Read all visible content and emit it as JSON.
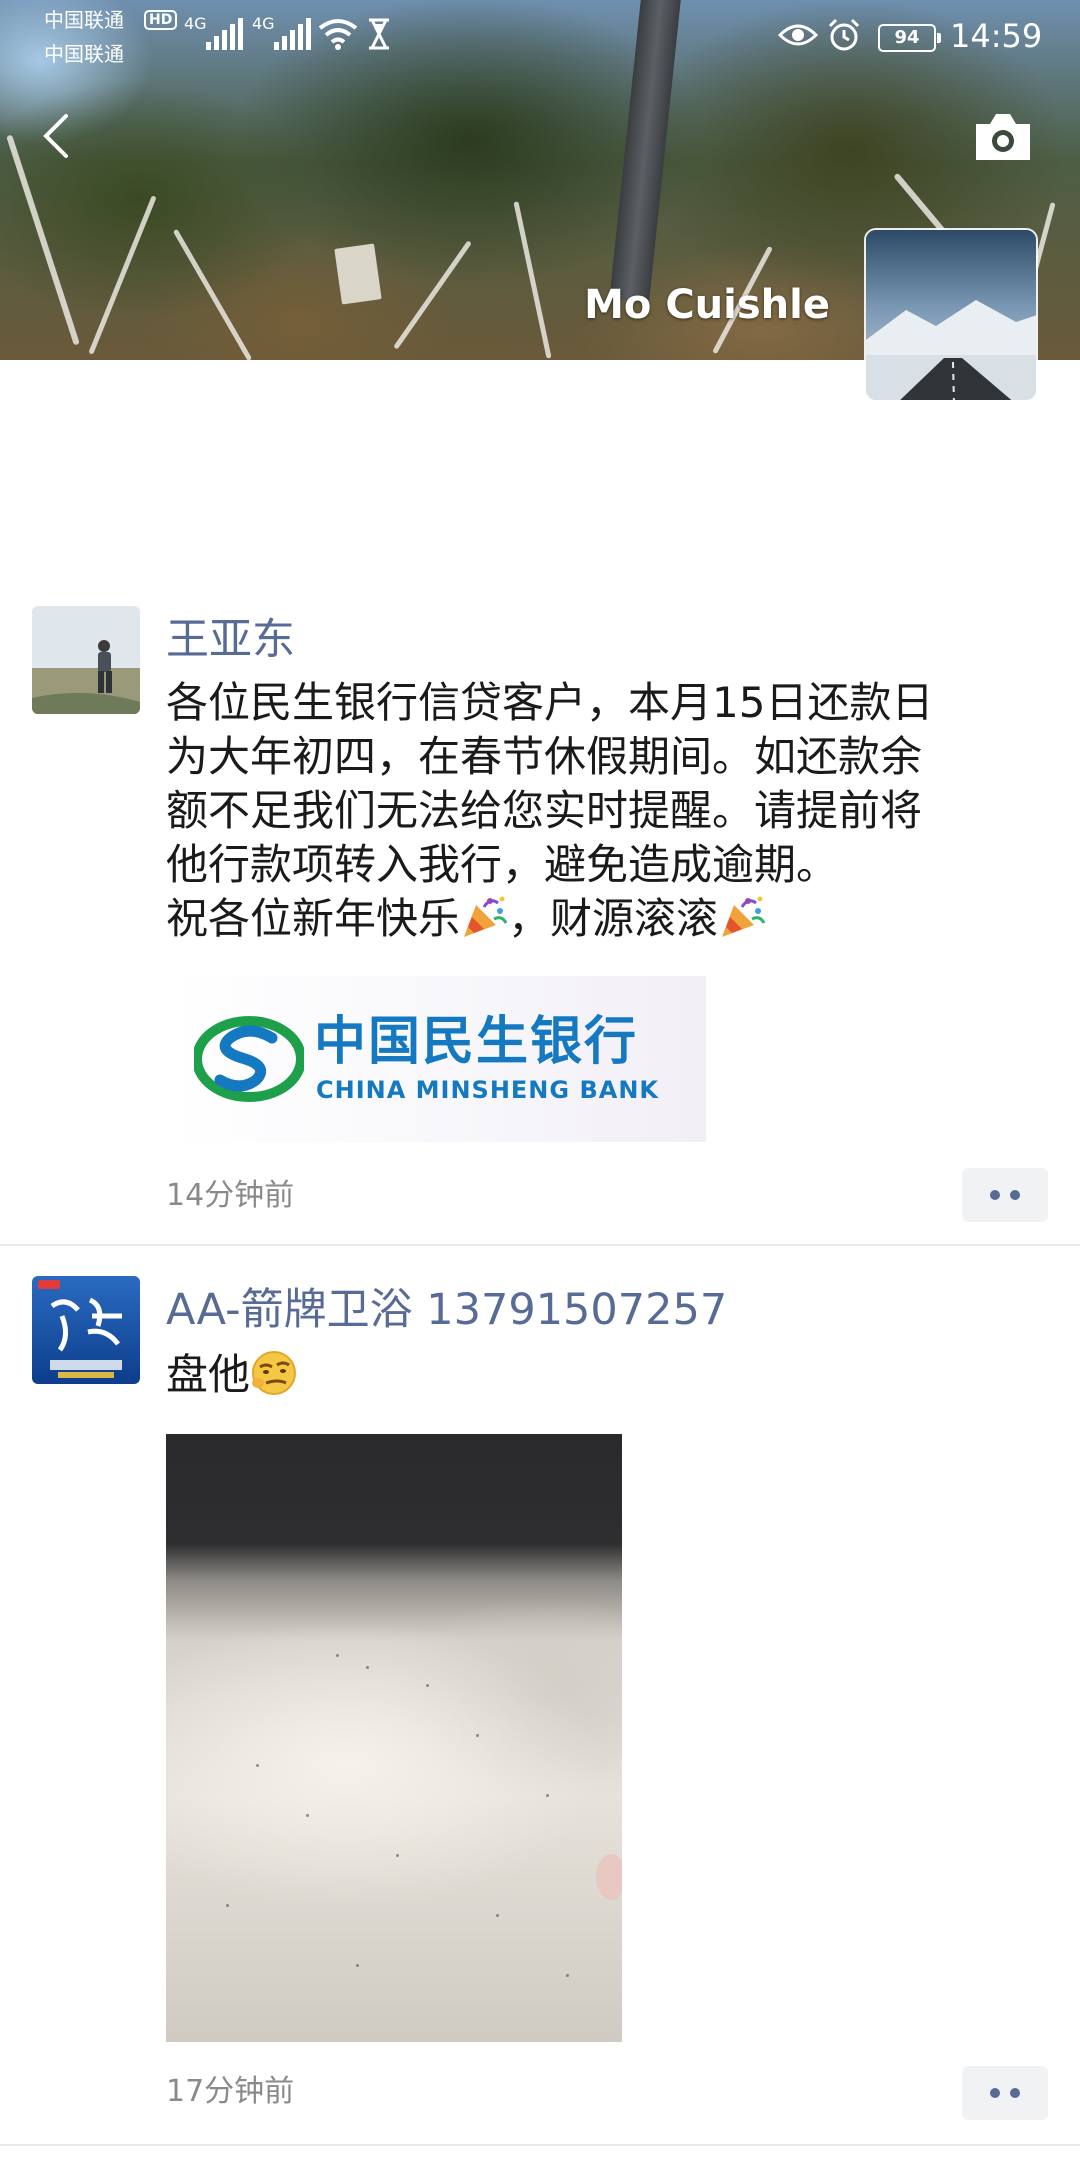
{
  "status_bar": {
    "carrier_1": "中国联通",
    "carrier_2": "中国联通",
    "hd_badge": "HD",
    "network_1": "4G",
    "network_2": "4G",
    "battery": "94",
    "time": "14:59",
    "icons": [
      "signal-icon",
      "wifi-icon",
      "hourglass-icon",
      "eye-icon",
      "alarm-icon",
      "battery-icon"
    ]
  },
  "header": {
    "profile_name": "Mo Cuishle",
    "back_icon": "chevron-left-icon",
    "camera_icon": "camera-icon"
  },
  "posts": [
    {
      "name": "王亚东",
      "text_lines": [
        "各位民生银行信贷客户，本月15日还款日",
        "为大年初四，在春节休假期间。如还款余",
        "额不足我们无法给您实时提醒。请提前将",
        "他行款项转入我行，避免造成逾期。",
        "祝各位新年快乐",
        "，财源滚滚"
      ],
      "image": {
        "bank_name_cn": "中国民生银行",
        "bank_name_en": "CHINA MINSHENG BANK"
      },
      "time": "14分钟前"
    },
    {
      "name": "AA-箭牌卫浴 13791507257",
      "text": "盘他",
      "time": "17分钟前"
    }
  ],
  "colors": {
    "name_link": "#576b95",
    "text": "#1a1a1a",
    "timestamp": "#8a8a8a",
    "bank_blue": "#1579c1",
    "bank_green": "#1ea04a"
  }
}
